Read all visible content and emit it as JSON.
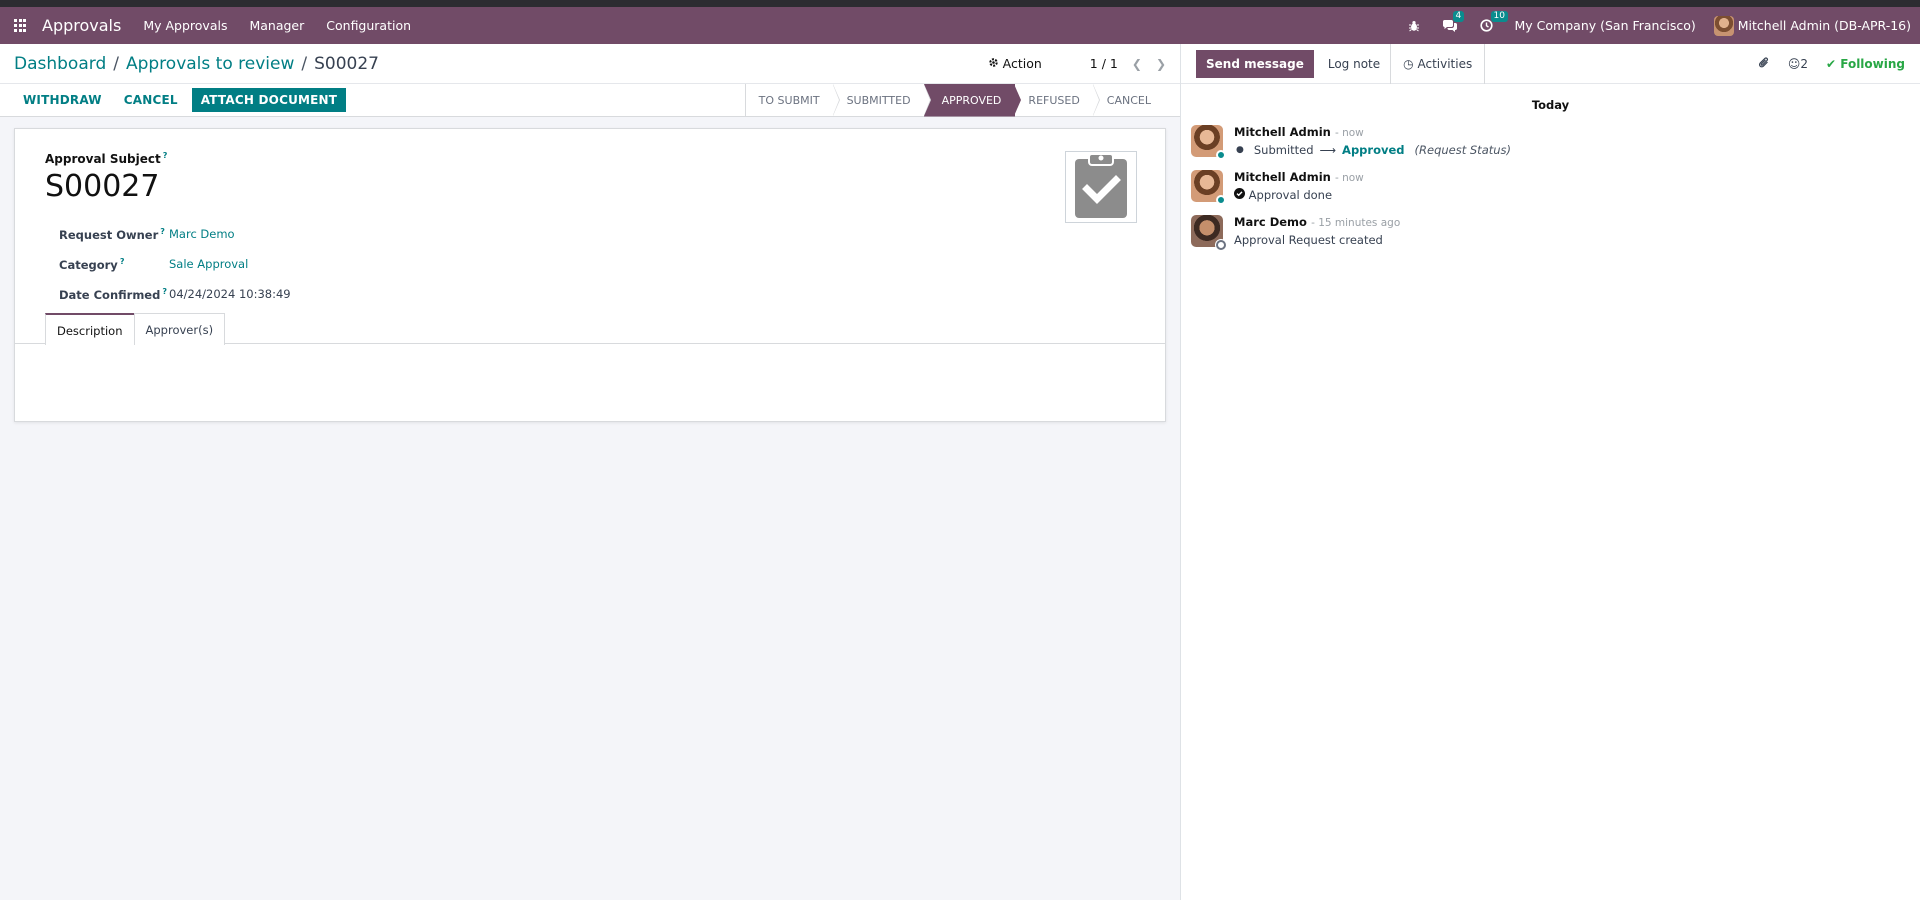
{
  "nav": {
    "app_name": "Approvals",
    "menu": [
      "My Approvals",
      "Manager",
      "Configuration"
    ],
    "chat_badge": "4",
    "activity_badge": "10",
    "company": "My Company (San Francisco)",
    "user": "Mitchell Admin (DB-APR-16)"
  },
  "breadcrumb": {
    "dashboard": "Dashboard",
    "approvals": "Approvals to review",
    "current": "S00027"
  },
  "control": {
    "action": "Action",
    "pager": "1 / 1"
  },
  "statusbar": {
    "withdraw": "WITHDRAW",
    "cancel": "CANCEL",
    "attach": "ATTACH DOCUMENT",
    "stages": [
      "TO SUBMIT",
      "SUBMITTED",
      "APPROVED",
      "REFUSED",
      "CANCEL"
    ],
    "active_stage": "APPROVED"
  },
  "form": {
    "subject_label": "Approval Subject",
    "title": "S00027",
    "fields": [
      {
        "label": "Request Owner",
        "value": "Marc Demo"
      },
      {
        "label": "Category",
        "value": "Sale Approval"
      },
      {
        "label": "Date Confirmed",
        "value": "04/24/2024 10:38:49"
      }
    ],
    "tabs": [
      "Description",
      "Approver(s)"
    ]
  },
  "chatter": {
    "send_message": "Send message",
    "log_note": "Log note",
    "activities": "Activities",
    "followers_count": "2",
    "following": "Following",
    "date_separator": "Today",
    "messages": [
      {
        "author": "Mitchell Admin",
        "time": "- now",
        "old_value": "Submitted",
        "new_value": "Approved",
        "field": "(Request Status)"
      },
      {
        "author": "Mitchell Admin",
        "time": "- now",
        "body": "Approval done"
      },
      {
        "author": "Marc Demo",
        "time": "- 15 minutes ago",
        "body": "Approval Request created"
      }
    ]
  }
}
